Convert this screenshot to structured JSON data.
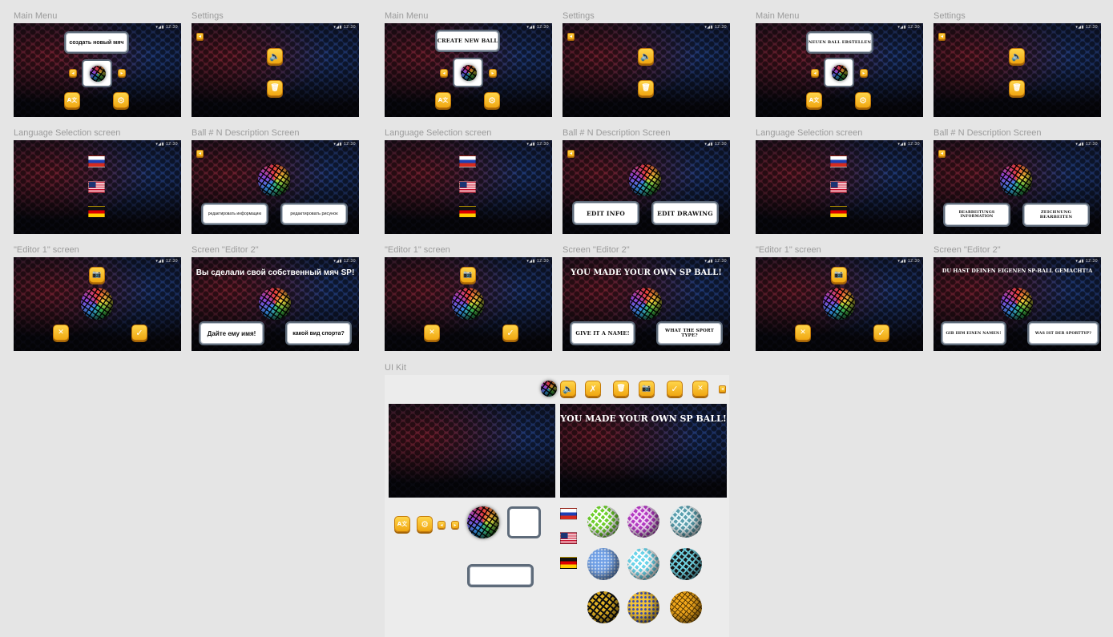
{
  "status_time": "12:30",
  "labels": {
    "main_menu": "Main Menu",
    "settings": "Settings",
    "language": "Language Selection screen",
    "ball_desc": "Ball # N Description Screen",
    "editor1": "\"Editor 1\" screen",
    "editor2": "Screen \"Editor 2\"",
    "ui_kit": "UI Kit"
  },
  "ru": {
    "create_ball": "создать новый мяч",
    "edit_info": "редактировать информацию",
    "edit_drawing": "редактировать рисунок",
    "title": "Вы сделали свой собственный мяч SP!",
    "give_name": "Дайте ему имя!",
    "sport_type": "какой вид спорта?"
  },
  "en": {
    "create_ball": "CREATE NEW BALL",
    "edit_info": "EDIT INFO",
    "edit_drawing": "EDIT DRAWING",
    "title": "YOU MADE YOUR OWN SP BALL!",
    "give_name": "GIVE IT A NAME!",
    "sport_type": "WHAT THE SPORT TYPE?"
  },
  "de": {
    "create_ball": "NEUEN BALL ERSTELLEN",
    "edit_info": "BEARBEITUNGS INFORMATION",
    "edit_drawing": "ZEICHNUNG BEARBEITEN",
    "title": "DU HAST DEINEN EIGENEN SP-BALL GEMACHT!A",
    "give_name": "GIB IHM EINEN NAMEN!",
    "sport_type": "WAS IST DER SPORTTYP?"
  },
  "icons": {
    "prev": "◂",
    "next": "▸",
    "lang": "A文",
    "gear": "⚙",
    "sound": "🔈",
    "trash": "🗑",
    "camera": "📷",
    "check": "✓",
    "close": "✕",
    "back": "◂",
    "mute": "✗"
  },
  "kit": {
    "title": "YOU MADE YOUR OWN SP BALL!"
  },
  "colors": {
    "button_yellow": "#f0a712",
    "button_border": "#5e6b7a",
    "canvas_bg": "#e5e5e5"
  }
}
